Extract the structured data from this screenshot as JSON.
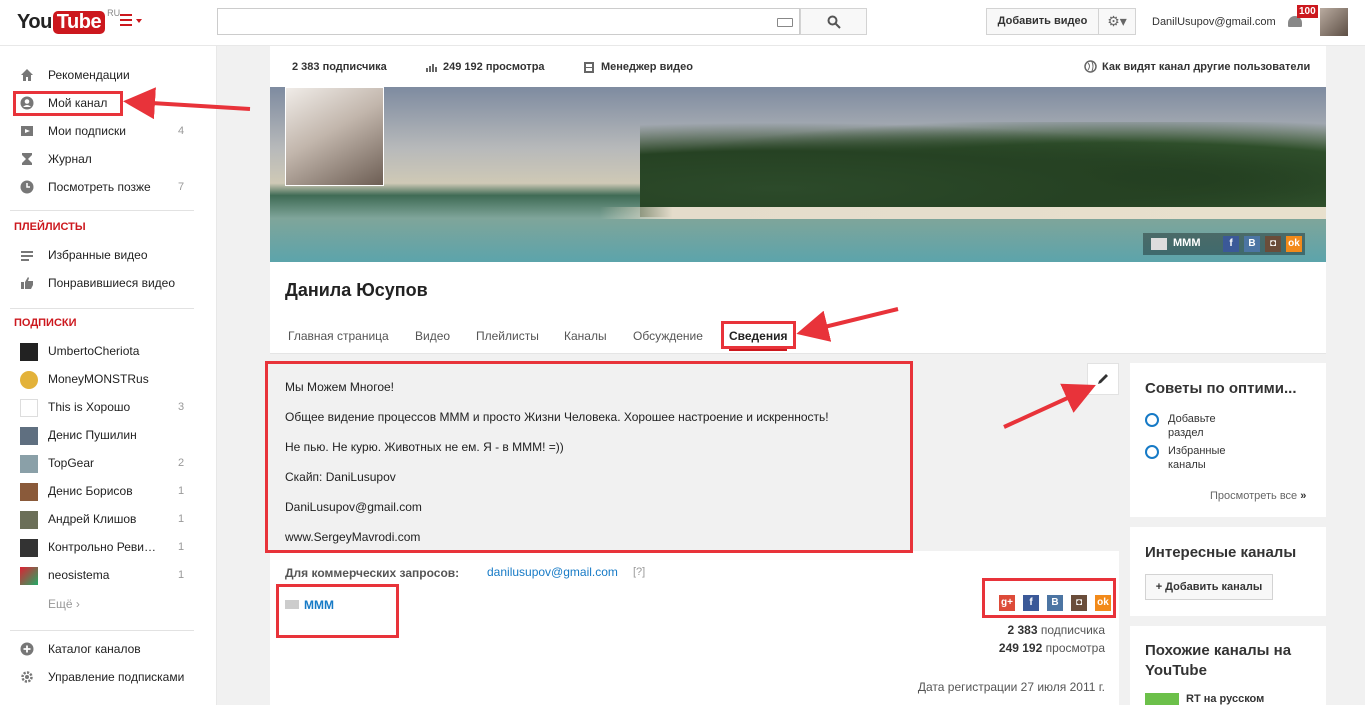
{
  "header": {
    "logo_you": "You",
    "logo_tube": "Tube",
    "logo_region": "RU",
    "search_placeholder": "",
    "upload_label": "Добавить видео",
    "user_email": "DanilUsupov@gmail.com",
    "notifications_count": "100"
  },
  "sidebar": {
    "main_items": [
      {
        "label": "Рекомендации",
        "icon": "home-icon"
      },
      {
        "label": "Мой канал",
        "icon": "user-icon"
      },
      {
        "label": "Мои подписки",
        "icon": "subscriptions-icon",
        "count": "4"
      },
      {
        "label": "Журнал",
        "icon": "history-icon"
      },
      {
        "label": "Посмотреть позже",
        "icon": "clock-icon",
        "count": "7"
      }
    ],
    "playlists_heading": "ПЛЕЙЛИСТЫ",
    "playlists": [
      {
        "label": "Избранные видео",
        "icon": "list-icon"
      },
      {
        "label": "Понравившиеся видео",
        "icon": "thumbs-up-icon"
      }
    ],
    "subscriptions_heading": "ПОДПИСКИ",
    "subscriptions": [
      {
        "label": "UmbertoCheriota",
        "count": ""
      },
      {
        "label": "MoneyMONSTRus",
        "count": ""
      },
      {
        "label": "This is Хорошо",
        "count": "3"
      },
      {
        "label": "Денис Пушилин",
        "count": ""
      },
      {
        "label": "TopGear",
        "count": "2"
      },
      {
        "label": "Денис Борисов",
        "count": "1"
      },
      {
        "label": "Андрей Клишов",
        "count": "1"
      },
      {
        "label": "Контрольно Реви…",
        "count": "1"
      },
      {
        "label": "neosistema",
        "count": "1"
      }
    ],
    "more_label": "Ещё ›",
    "bottom_items": [
      {
        "label": "Каталог каналов",
        "icon": "plus-circle-icon"
      },
      {
        "label": "Управление подписками",
        "icon": "gear-icon"
      }
    ]
  },
  "channel": {
    "subscribers_stat": "2 383 подписчика",
    "views_stat": "249 192 просмотра",
    "video_manager": "Менеджер видео",
    "view_as": "Как видят канал другие пользователи",
    "banner_link": "МММ",
    "title": "Данила Юсупов",
    "tabs": [
      "Главная страница",
      "Видео",
      "Плейлисты",
      "Каналы",
      "Обсуждение",
      "Сведения"
    ]
  },
  "about": {
    "description": [
      "Мы Можем Многое!",
      "Общее видение процессов МММ и просто Жизни Человека. Хорошее настроение и искренность!",
      "Не пью. Не курю. Животных не ем. Я - в МММ! =))",
      "Скайп: DaniLusupov",
      "DaniLusupov@gmail.com",
      "www.SergeyMavrodi.com"
    ],
    "commerce_label": "Для коммерческих запросов:",
    "commerce_email": "danilusupov@gmail.com",
    "commerce_help": "[?]",
    "link_label": "МММ",
    "subscribers_num": "2 383",
    "subscribers_word": "подписчика",
    "views_num": "249 192",
    "views_word": "просмотра",
    "joined": "Дата регистрации 27 июля 2011 г."
  },
  "right": {
    "tips_title": "Советы по оптими...",
    "tips": [
      "Добавьте раздел",
      "Избранные каналы"
    ],
    "tips_more": "Просмотреть все",
    "interesting_title": "Интересные каналы",
    "add_channels": "+ Добавить каналы",
    "similar_title_1": "Похожие каналы на",
    "similar_title_2": "YouTube",
    "similar_first": "RT на русском"
  },
  "colors": {
    "accent": "#cc181e",
    "link": "#167ac6",
    "annotation": "#e8333a"
  }
}
